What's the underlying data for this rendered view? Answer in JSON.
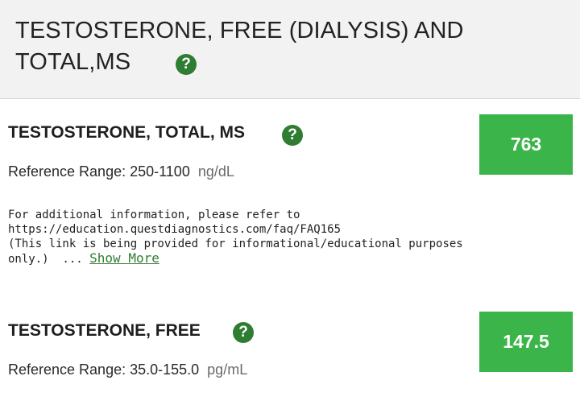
{
  "header": {
    "title_line1": "TESTOSTERONE, FREE (DIALYSIS) AND",
    "title_line2": "TOTAL,MS",
    "help_symbol": "?"
  },
  "tests": [
    {
      "name": "TESTOSTERONE, TOTAL, MS",
      "help_symbol": "?",
      "reference_label": "Reference Range: 250-1100",
      "unit": "ng/dL",
      "value": "763",
      "note_lines": [
        "For additional information, please refer to",
        "https://education.questdiagnostics.com/faq/FAQ165",
        "(This link is being provided for informational/educational purposes",
        "only.)  ... "
      ],
      "show_more_label": "Show More"
    },
    {
      "name": "TESTOSTERONE, FREE",
      "help_symbol": "?",
      "reference_label": "Reference Range: 35.0-155.0",
      "unit": "pg/mL",
      "value": "147.5"
    }
  ],
  "colors": {
    "accent_green": "#2e7d32",
    "result_green": "#3bb54a",
    "header_bg": "#f2f2f2"
  }
}
